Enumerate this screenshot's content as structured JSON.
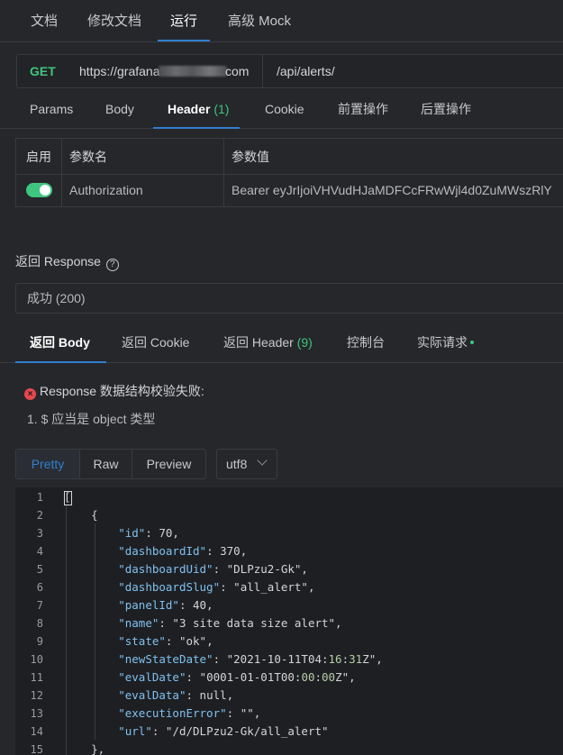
{
  "top_tabs": [
    "文档",
    "修改文档",
    "运行",
    "高级 Mock"
  ],
  "active_top_tab": "运行",
  "request": {
    "method": "GET",
    "host_prefix": "https://grafana",
    "host_suffix": "com",
    "path": "/api/alerts/"
  },
  "request_tabs": {
    "params": "Params",
    "body": "Body",
    "header": "Header",
    "header_count": "(1)",
    "cookie": "Cookie",
    "pre": "前置操作",
    "post": "后置操作"
  },
  "header_table": {
    "columns": [
      "启用",
      "参数名",
      "参数值"
    ],
    "rows": [
      {
        "enabled": true,
        "name": "Authorization",
        "value": "Bearer eyJrIjoiVHVudHJaMDFCcFRwWjl4d0ZuMWszRlY"
      }
    ]
  },
  "response": {
    "title": "返回 Response",
    "help_icon": "question-circle-icon",
    "status": "成功 (200)",
    "tabs": {
      "body": "返回 Body",
      "cookie": "返回 Cookie",
      "header": "返回 Header",
      "header_count": "(9)",
      "console": "控制台",
      "actual": "实际请求"
    },
    "validation_error": "Response 数据结构校验失败:",
    "validation_items": [
      "1. $ 应当是 object 类型"
    ],
    "format_buttons": [
      "Pretty",
      "Raw",
      "Preview"
    ],
    "active_format": "Pretty",
    "encoding": "utf8"
  },
  "code_lines": [
    "[",
    "    {",
    "        \"id\": 70,",
    "        \"dashboardId\": 370,",
    "        \"dashboardUid\": \"DLPzu2-Gk\",",
    "        \"dashboardSlug\": \"all_alert\",",
    "        \"panelId\": 40,",
    "        \"name\": \"3 site data size alert\",",
    "        \"state\": \"ok\",",
    "        \"newStateDate\": \"2021-10-11T04:16:31Z\",",
    "        \"evalDate\": \"0001-01-01T00:00:00Z\",",
    "        \"evalData\": null,",
    "        \"executionError\": \"\",",
    "        \"url\": \"/d/DLPzu2-Gk/all_alert\"",
    "    },"
  ],
  "colors": {
    "accent": "#2f7fd0",
    "success": "#3ec57f",
    "error": "#e5484d",
    "json_key": "#7fc1f0",
    "json_string": "#d69b6e",
    "json_number": "#b5cea8"
  }
}
